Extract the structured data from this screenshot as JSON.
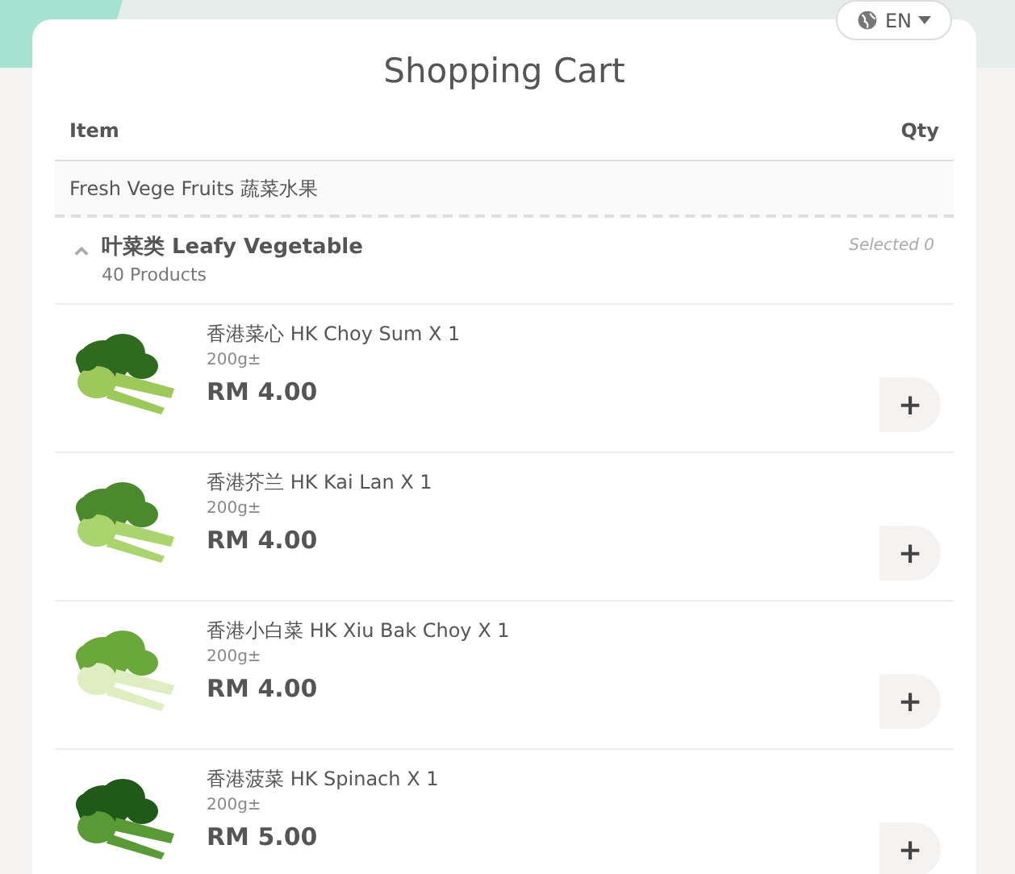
{
  "language_button": {
    "label": "EN"
  },
  "title": "Shopping Cart",
  "table": {
    "columns": [
      "Item",
      "Qty"
    ]
  },
  "category": {
    "name": "Fresh Vege Fruits 蔬菜水果"
  },
  "group": {
    "name": "叶菜类 Leafy Vegetable",
    "count": "40 Products",
    "selected_text": "Selected 0",
    "expanded": true
  },
  "products": [
    {
      "name": "香港菜心 HK Choy Sum X 1",
      "weight": "200g±",
      "price": "RM 4.00",
      "add": "+"
    },
    {
      "name": "香港芥兰 HK Kai Lan X 1",
      "weight": "200g±",
      "price": "RM 4.00",
      "add": "+"
    },
    {
      "name": "香港小白菜 HK Xiu Bak Choy X 1",
      "weight": "200g±",
      "price": "RM 4.00",
      "add": "+"
    },
    {
      "name": "香港菠菜 HK Spinach X 1",
      "weight": "200g±",
      "price": "RM 5.00",
      "add": "+"
    }
  ]
}
